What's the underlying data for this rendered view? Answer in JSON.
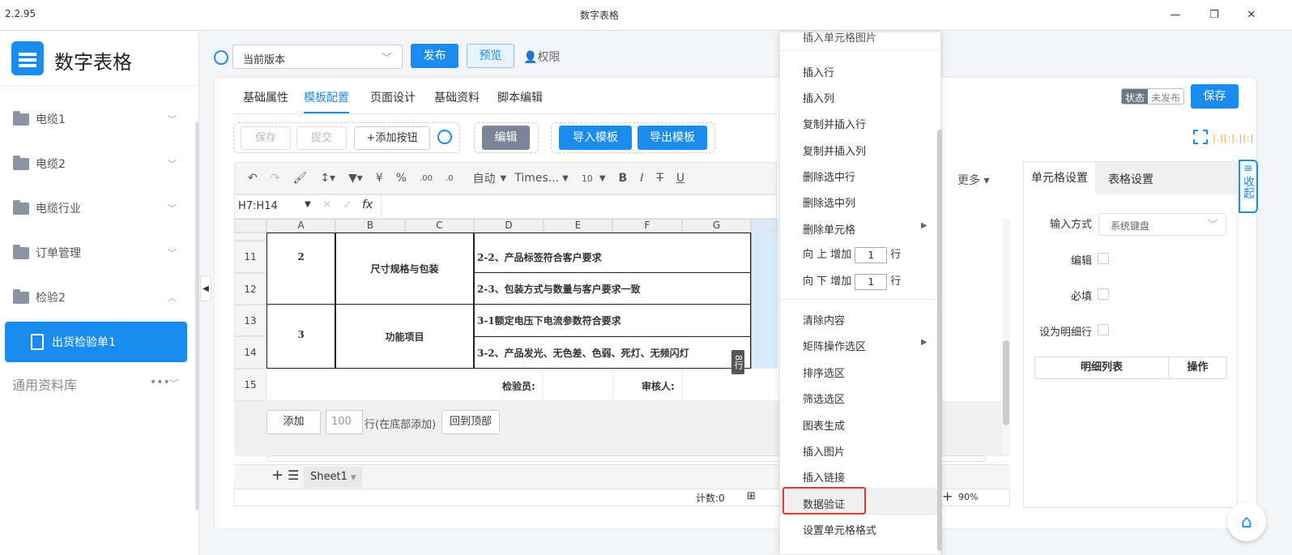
{
  "window": {
    "version": "2.2.95",
    "title": "数字表格"
  },
  "sidebar": {
    "app_name": "数字表格",
    "items": [
      {
        "label": "电缆1"
      },
      {
        "label": "电缆2"
      },
      {
        "label": "电缆行业"
      },
      {
        "label": "订单管理"
      },
      {
        "label": "检验2"
      }
    ],
    "active": "出货检验单1",
    "library": "通用资料库"
  },
  "topbar": {
    "version_select": "当前版本",
    "publish": "发布",
    "preview": "预览",
    "permission": "权限"
  },
  "tabs": [
    "基础属性",
    "模板配置",
    "页面设计",
    "基础资料",
    "脚本编辑"
  ],
  "status": {
    "label": "状态",
    "value": "未发布"
  },
  "save": "保存",
  "actions": {
    "save": "保存",
    "submit": "提交",
    "add_button": "+添加按钮",
    "edit": "编辑",
    "import": "导入模板",
    "export": "导出模板"
  },
  "toolbar": {
    "auto": "自动",
    "font": "Times...",
    "size": "10",
    "more": "更多",
    "currency": "¥",
    "percent": "%"
  },
  "formula": {
    "cellref": "H7:H14",
    "fx": "fx"
  },
  "columns": [
    "A",
    "B",
    "C",
    "D",
    "E",
    "F",
    "G"
  ],
  "rows": [
    {
      "num": "11",
      "a": "2",
      "b": "尺寸规格与包装",
      "d": "2-2、产品标签符合客户要求"
    },
    {
      "num": "12",
      "d": "2-3、包装方式与数量与客户要求一致"
    },
    {
      "num": "13",
      "a": "3",
      "b": "功能项目",
      "d": "3-1额定电压下电流参数符合要求"
    },
    {
      "num": "14",
      "d": "3-2、产品发光、无色差、色弱、死灯、无频闪灯"
    },
    {
      "num": "15",
      "inspector": "检验员:",
      "reviewer": "审核人:"
    }
  ],
  "row_tag": "8行",
  "bottom": {
    "add": "添加",
    "count": "100",
    "rows_hint": "行(在底部添加)",
    "back_top": "回到顶部",
    "sheet": "Sheet1",
    "count_label": "计数:0",
    "zoom": "90%"
  },
  "menu": {
    "top": "插入单元格图片",
    "items1": [
      "插入行",
      "插入列",
      "复制并插入行",
      "复制并插入列",
      "删除选中行",
      "删除选中列",
      "删除单元格"
    ],
    "up": {
      "a": "向 上 增加",
      "v": "1",
      "u": "行"
    },
    "down": {
      "a": "向 下 增加",
      "v": "1",
      "u": "行"
    },
    "items2": [
      "清除内容",
      "矩阵操作选区",
      "排序选区",
      "筛选选区",
      "图表生成",
      "插入图片",
      "插入链接",
      "数据验证",
      "设置单元格格式"
    ]
  },
  "rpanel": {
    "tab1": "单元格设置",
    "tab2": "表格设置",
    "input_label": "输入方式",
    "input_value": "系统键盘",
    "edit": "编辑",
    "required": "必填",
    "detail": "设为明细行",
    "table_h1": "明细列表",
    "table_h2": "操作",
    "collapse": "收起"
  }
}
